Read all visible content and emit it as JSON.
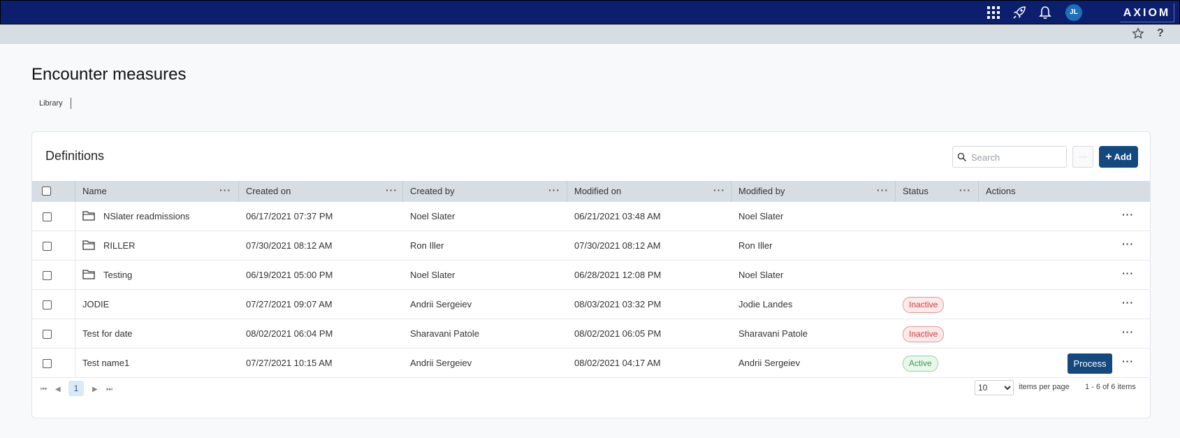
{
  "header": {
    "brand": "AXIOM",
    "user_initials": "JL",
    "icons": [
      "apps-grid-icon",
      "rocket-icon",
      "bell-icon"
    ],
    "brand_color": "#0b1f6e"
  },
  "subheader": {
    "help_label": "?",
    "icons": [
      "star-icon",
      "help-icon"
    ]
  },
  "page": {
    "title": "Encounter measures",
    "breadcrumb": "Library"
  },
  "panel": {
    "title": "Definitions",
    "search_placeholder": "Search",
    "more_label": "···",
    "add_label": "Add",
    "accent_color": "#13497f"
  },
  "table": {
    "columns": [
      "Name",
      "Created on",
      "Created by",
      "Modified on",
      "Modified by",
      "Status",
      "Actions"
    ],
    "menu_glyph": "···",
    "rows": [
      {
        "name": "NSlater readmissions",
        "is_folder": true,
        "created_on": "06/17/2021 07:37 PM",
        "created_by": "Noel Slater",
        "modified_on": "06/21/2021 03:48 AM",
        "modified_by": "Noel Slater",
        "status": ""
      },
      {
        "name": "RILLER",
        "is_folder": true,
        "created_on": "07/30/2021 08:12 AM",
        "created_by": "Ron Iller",
        "modified_on": "07/30/2021 08:12 AM",
        "modified_by": "Ron Iller",
        "status": ""
      },
      {
        "name": "Testing",
        "is_folder": true,
        "created_on": "06/19/2021 05:00 PM",
        "created_by": "Noel Slater",
        "modified_on": "06/28/2021 12:08 PM",
        "modified_by": "Noel Slater",
        "status": ""
      },
      {
        "name": "JODIE",
        "is_folder": false,
        "created_on": "07/27/2021 09:07 AM",
        "created_by": "Andrii Sergeiev",
        "modified_on": "08/03/2021 03:32 PM",
        "modified_by": "Jodie Landes",
        "status": "Inactive"
      },
      {
        "name": "Test for date",
        "is_folder": false,
        "created_on": "08/02/2021 06:04 PM",
        "created_by": "Sharavani Patole",
        "modified_on": "08/02/2021 06:05 PM",
        "modified_by": "Sharavani Patole",
        "status": "Inactive"
      },
      {
        "name": "Test name1",
        "is_folder": false,
        "created_on": "07/27/2021 10:15 AM",
        "created_by": "Andrii Sergeiev",
        "modified_on": "08/02/2021 04:17 AM",
        "modified_by": "Andrii Sergeiev",
        "status": "Active",
        "action_button": "Process"
      }
    ]
  },
  "pagination": {
    "current_page": "1",
    "page_size": "10",
    "page_size_options": [
      "10"
    ],
    "items_per_page_label": "items per page",
    "range_text": "1 - 6 of 6 items"
  }
}
